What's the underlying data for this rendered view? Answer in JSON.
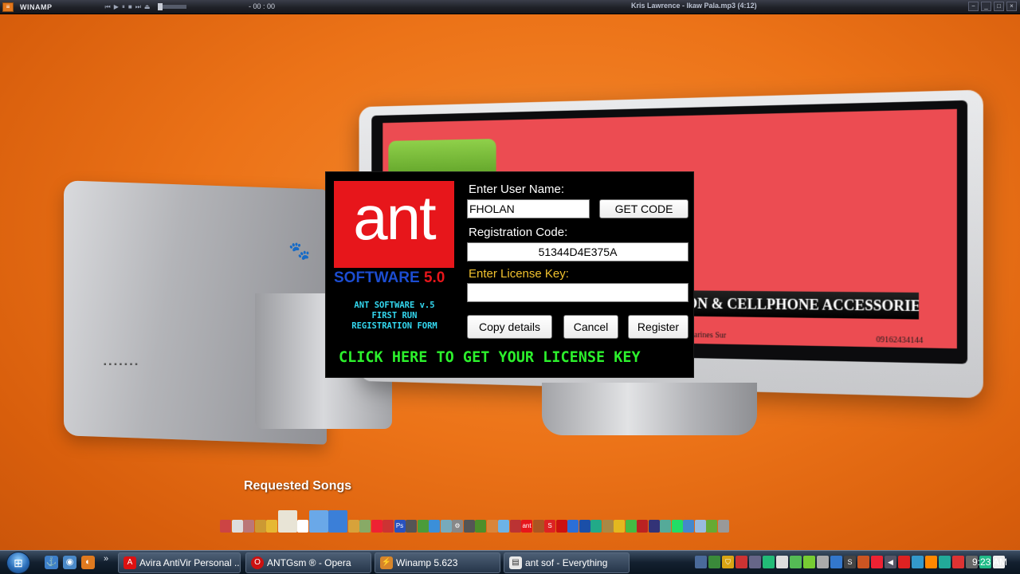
{
  "winamp": {
    "title": "WINAMP",
    "time": "- 00 : 00",
    "track": "Kris Lawrence - Ikaw Pala.mp3 (4:12)"
  },
  "background": {
    "screen_tagline": "ON & CELLPHONE ACCESSORIES",
    "screen_location": "marines Sur",
    "screen_phone": "09162434144"
  },
  "dialog": {
    "logo_text": "ant",
    "logo_software": "SOFTWARE",
    "logo_version": "5.0",
    "caption_line1": "ANT SOFTWARE v.5",
    "caption_line2": "FIRST RUN",
    "caption_line3": "REGISTRATION FORM",
    "username_label": "Enter User Name:",
    "username_value": "FHOLAN",
    "get_code_label": "GET CODE",
    "regcode_label": "Registration Code:",
    "regcode_value": "51344D4E375A",
    "license_label": "Enter License Key:",
    "license_value": "",
    "copy_label": "Copy details",
    "cancel_label": "Cancel",
    "register_label": "Register",
    "license_link": "CLICK HERE TO GET YOUR LICENSE KEY",
    "colors": {
      "logo_red": "#e7161b",
      "logo_blue": "#1c4dd1",
      "caption_cyan": "#33d8f0",
      "license_yellow": "#f2c22e",
      "link_green": "#2cf02c"
    }
  },
  "desktop": {
    "requested_label": "Requested Songs"
  },
  "taskbar": {
    "tasks": [
      {
        "label": "Avira AntiVir Personal ...",
        "icon": "avira-icon"
      },
      {
        "label": "ANTGsm ® - Opera",
        "icon": "opera-icon"
      },
      {
        "label": "Winamp 5.623",
        "icon": "winamp-icon"
      },
      {
        "label": "ant sof - Everything",
        "icon": "everything-search-icon"
      }
    ],
    "quick_launch_more": "»",
    "clock": "9:23 AM"
  }
}
